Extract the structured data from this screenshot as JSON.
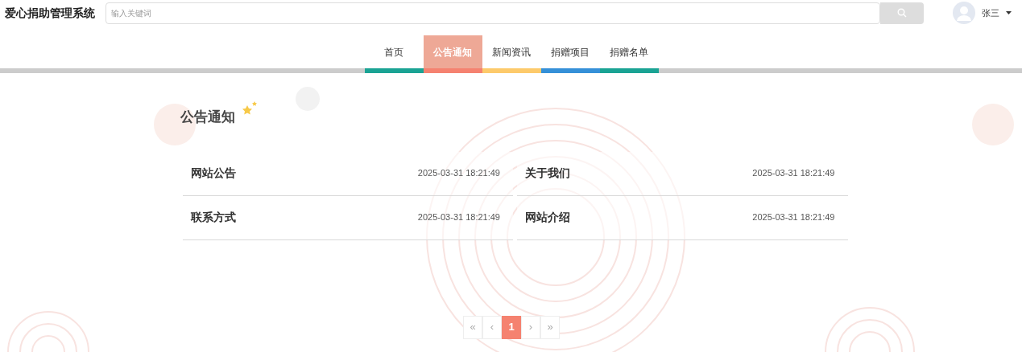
{
  "header": {
    "title": "爱心捐助管理系统",
    "search": {
      "placeholder": "输入关键词"
    },
    "user": {
      "name": "张三"
    }
  },
  "nav": [
    {
      "label": "首页",
      "selected": false,
      "color": "#1aa394"
    },
    {
      "label": "公告通知",
      "selected": true,
      "color": "#f58270"
    },
    {
      "label": "新闻资讯",
      "selected": false,
      "color": "#fdca6b"
    },
    {
      "label": "捐赠项目",
      "selected": false,
      "color": "#3590d8"
    },
    {
      "label": "捐赠名单",
      "selected": false,
      "color": "#1aa394"
    }
  ],
  "section": {
    "title": "公告通知"
  },
  "notices": [
    {
      "title": "网站公告",
      "time": "2025-03-31 18:21:49"
    },
    {
      "title": "关于我们",
      "time": "2025-03-31 18:21:49"
    },
    {
      "title": "联系方式",
      "time": "2025-03-31 18:21:49"
    },
    {
      "title": "网站介绍",
      "time": "2025-03-31 18:21:49"
    }
  ],
  "pagination": [
    {
      "label": "«",
      "selected": false
    },
    {
      "label": "‹",
      "selected": false
    },
    {
      "label": "1",
      "selected": true
    },
    {
      "label": "›",
      "selected": false
    },
    {
      "label": "»",
      "selected": false
    }
  ]
}
